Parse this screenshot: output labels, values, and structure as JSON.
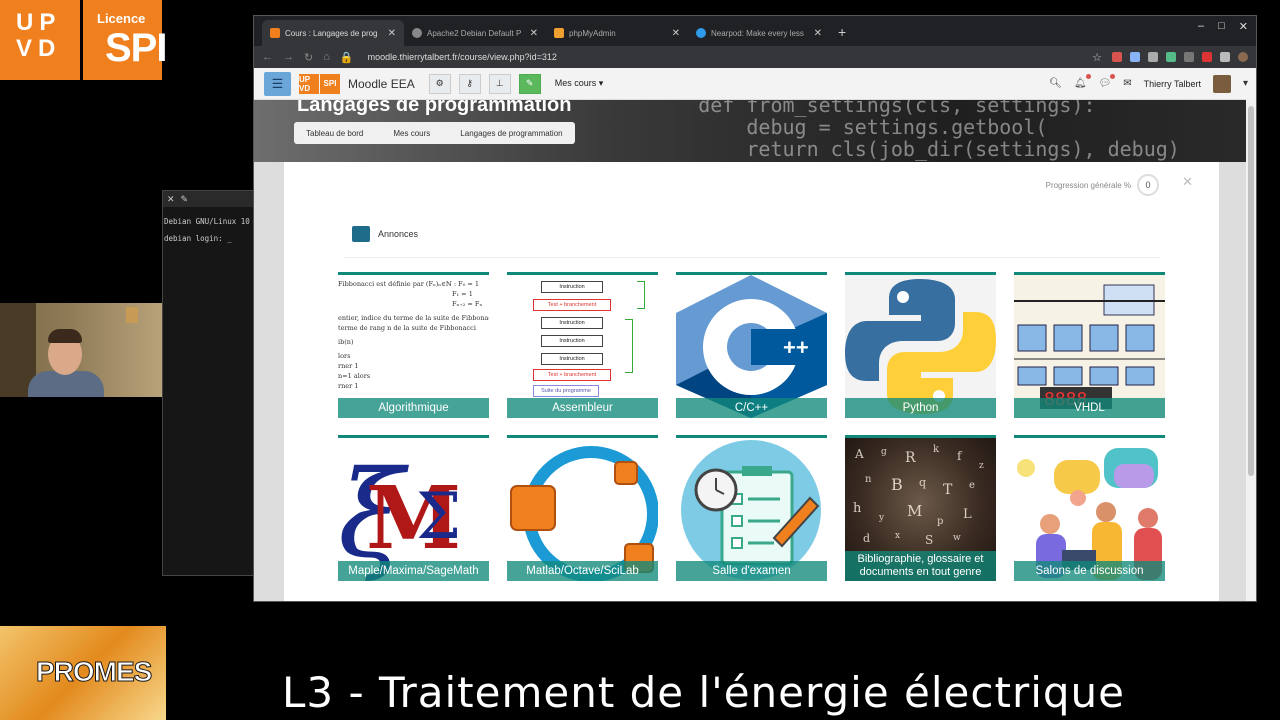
{
  "overlay": {
    "logo_left": [
      "U",
      "P",
      "V",
      "D"
    ],
    "logo_licence": "Licence",
    "logo_spi": "SPI",
    "terminal_line1": "Debian GNU/Linux 10",
    "terminal_line2": "debian login: _",
    "promes": "PROMES",
    "caption": "L3 - Traitement de l'énergie électrique"
  },
  "browser": {
    "tabs": [
      {
        "label": "Cours : Langages de prog",
        "color": "#f07f1e",
        "active": true
      },
      {
        "label": "Apache2 Debian Default P",
        "color": "#888888",
        "active": false
      },
      {
        "label": "phpMyAdmin",
        "color": "#f0a030",
        "active": false
      },
      {
        "label": "Nearpod: Make every less",
        "color": "#2f9be8",
        "active": false
      }
    ],
    "new_tab": "+",
    "url": "moodle.thierrytalbert.fr/course/view.php?id=312"
  },
  "moodle": {
    "logo": [
      "UP VD",
      "SPI"
    ],
    "site_name": "Moodle EEA",
    "mes_cours": "Mes cours",
    "user_name": "Thierry Talbert",
    "page_title": "Langages de programmation",
    "breadcrumb": [
      "Tableau de bord",
      "Mes cours",
      "Langages de programmation"
    ],
    "progress_label": "Progression générale %",
    "progress_value": "0",
    "annonces": "Annonces",
    "tiles": [
      "Algorithmique",
      "Assembleur",
      "C/C++",
      "Python",
      "VHDL",
      "Maple/Maxima/SageMath",
      "Matlab/Octave/SciLab",
      "Salle d'examen",
      "Bibliographie, glossaire et documents en tout genre",
      "Salons de discussion"
    ],
    "algo_lines": [
      "Fibbonacci est définie par (Fₙ)ₙ∈ℕ : F₀ = 1",
      "F₁ = 1",
      "Fₙ₊₂ = Fₙ",
      "entier, indice du terme de la suite de Fibbonacci",
      "terme de rang n de la suite de Fibbonacci",
      "ib(n)",
      "lors",
      "rner 1",
      "n=1 alors",
      "rner 1"
    ],
    "asm_boxes": [
      "Instruction",
      "Test + branchement",
      "Instruction",
      "Instruction",
      "Instruction",
      "Test + branchement",
      "Suite du programme"
    ],
    "cpp_mark": "C++",
    "vhdl_display": "8888"
  },
  "colors": {
    "upvd_orange": "#f07f1e",
    "teal": "#11897a",
    "menu_blue": "#6aa7d8"
  }
}
